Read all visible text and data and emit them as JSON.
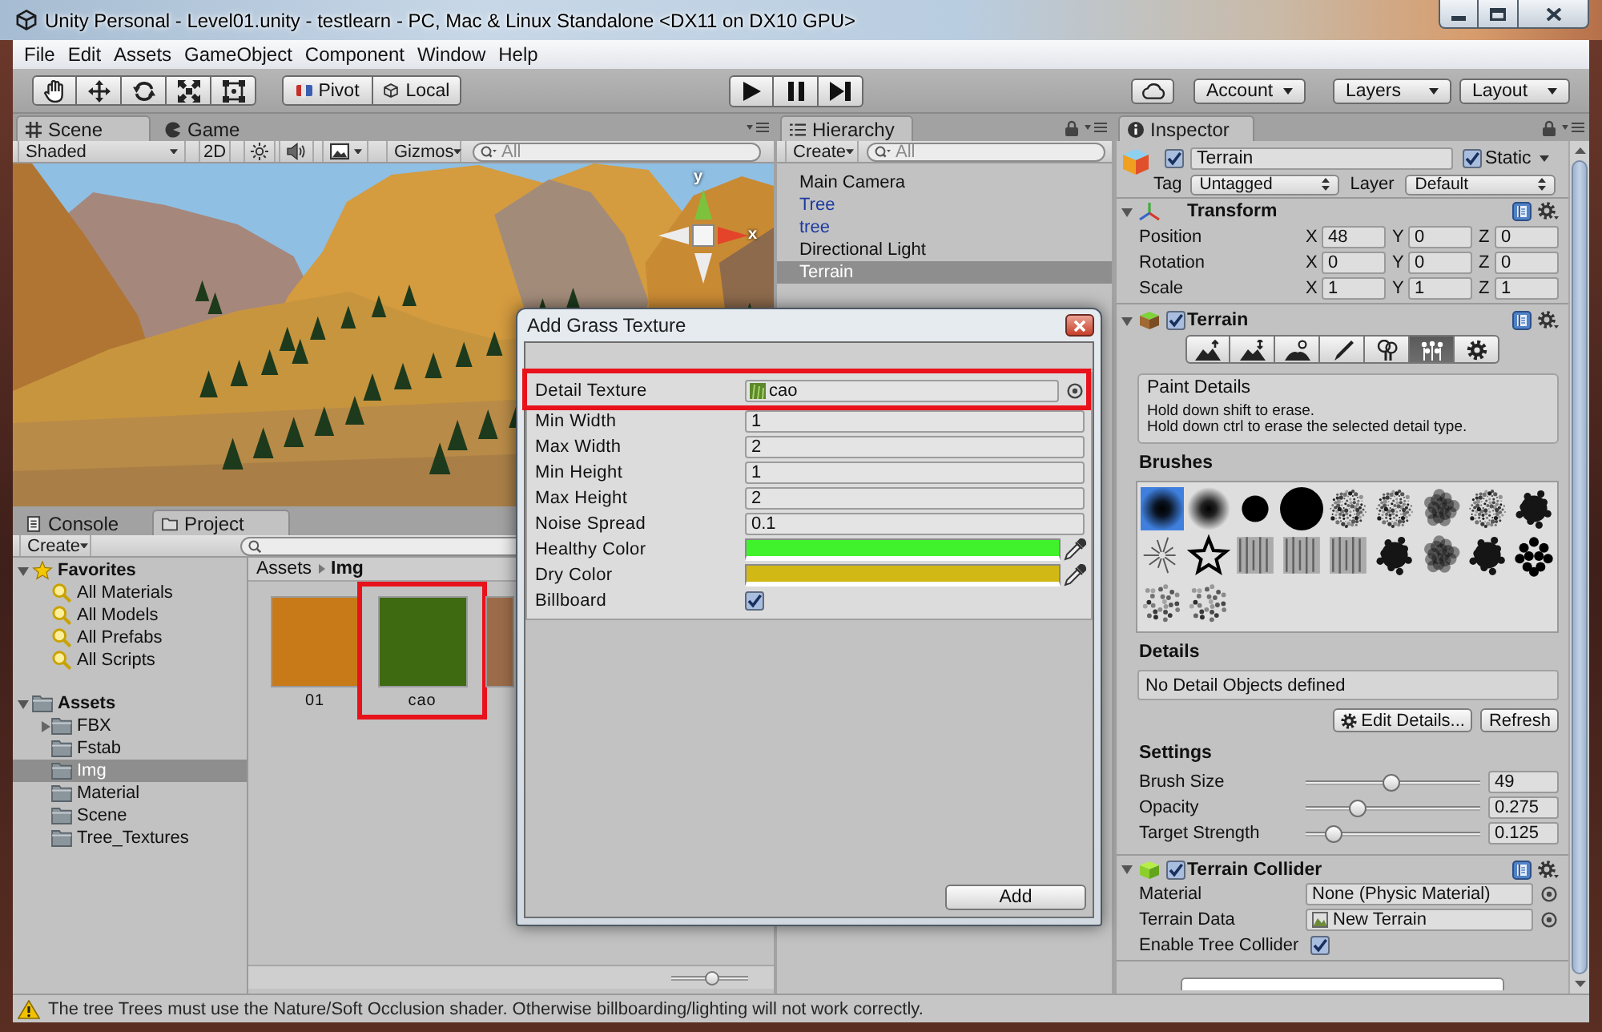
{
  "window": {
    "title": "Unity Personal - Level01.unity - testlearn - PC, Mac & Linux Standalone <DX11 on DX10 GPU>"
  },
  "menu": [
    "File",
    "Edit",
    "Assets",
    "GameObject",
    "Component",
    "Window",
    "Help"
  ],
  "toolbar": {
    "tools": [
      {
        "kind": "hand"
      },
      {
        "kind": "move"
      },
      {
        "kind": "rotate"
      },
      {
        "kind": "scale"
      },
      {
        "kind": "rect"
      }
    ],
    "handles": [
      {
        "kind": "pivot",
        "label": "Pivot"
      },
      {
        "kind": "local",
        "label": "Local"
      }
    ],
    "playback": [
      {
        "kind": "play",
        "on": false
      },
      {
        "kind": "pause",
        "on": false
      },
      {
        "kind": "step",
        "on": false
      }
    ],
    "account": "Account",
    "layers": "Layers",
    "layout": "Layout"
  },
  "scene": {
    "tabs": [
      {
        "kind": "scene",
        "label": "Scene",
        "selected": true
      },
      {
        "kind": "game",
        "label": "Game",
        "selected": false
      }
    ],
    "shading": "Shaded",
    "mode_2d": {
      "label": "2D",
      "on": false
    },
    "lighting": {
      "on": false
    },
    "audio": {
      "on": false
    },
    "gizmos": "Gizmos",
    "search": {
      "placeholder": "All"
    },
    "axes": [
      "y",
      "x"
    ]
  },
  "hierarchy": {
    "title": "Hierarchy",
    "create": "Create",
    "search": {
      "placeholder": "All"
    },
    "items": [
      {
        "name": "Main Camera",
        "prefab": false,
        "selected": false
      },
      {
        "name": "Tree",
        "prefab": true,
        "selected": false
      },
      {
        "name": "tree",
        "prefab": true,
        "selected": false
      },
      {
        "name": "Directional Light",
        "prefab": false,
        "selected": false
      },
      {
        "name": "Terrain",
        "prefab": false,
        "selected": true
      }
    ]
  },
  "inspector": {
    "title": "Inspector",
    "object": {
      "active": true,
      "name": "Terrain",
      "static": true,
      "static_label": "Static",
      "tag_label": "Tag",
      "tag": "Untagged",
      "layer_label": "Layer",
      "layer": "Default"
    },
    "transform": {
      "title": "Transform",
      "expanded": true,
      "rows": [
        {
          "label": "Position",
          "values": [
            {
              "axis": "X",
              "value": "48"
            },
            {
              "axis": "Y",
              "value": "0"
            },
            {
              "axis": "Z",
              "value": "0"
            }
          ]
        },
        {
          "label": "Rotation",
          "values": [
            {
              "axis": "X",
              "value": "0"
            },
            {
              "axis": "Y",
              "value": "0"
            },
            {
              "axis": "Z",
              "value": "0"
            }
          ]
        },
        {
          "label": "Scale",
          "values": [
            {
              "axis": "X",
              "value": "1"
            },
            {
              "axis": "Y",
              "value": "1"
            },
            {
              "axis": "Z",
              "value": "1"
            }
          ]
        }
      ]
    },
    "terrain": {
      "title": "Terrain",
      "enabled": true,
      "expanded": true,
      "tools": [
        {
          "kind": "raise",
          "selected": false
        },
        {
          "kind": "height",
          "selected": false
        },
        {
          "kind": "smooth",
          "selected": false
        },
        {
          "kind": "texture",
          "selected": false
        },
        {
          "kind": "trees",
          "selected": false
        },
        {
          "kind": "details",
          "selected": true
        },
        {
          "kind": "settings",
          "selected": false
        }
      ],
      "help": {
        "title": "Paint Details",
        "lines": [
          "Hold down shift to erase.",
          "Hold down ctrl to erase the selected detail type."
        ]
      },
      "brushes_label": "Brushes",
      "brushes": [
        {
          "kind": "soft",
          "selected": true
        },
        {
          "kind": "soft",
          "selected": false
        },
        {
          "kind": "dot",
          "selected": false
        },
        {
          "kind": "disc",
          "selected": false
        },
        {
          "kind": "spray",
          "selected": false
        },
        {
          "kind": "spray",
          "selected": false
        },
        {
          "kind": "cloud",
          "selected": false
        },
        {
          "kind": "spray",
          "selected": false
        },
        {
          "kind": "blob",
          "selected": false
        },
        {
          "kind": "burst",
          "selected": false
        },
        {
          "kind": "star",
          "selected": false
        },
        {
          "kind": "square",
          "selected": false
        },
        {
          "kind": "square",
          "selected": false
        },
        {
          "kind": "square",
          "selected": false
        },
        {
          "kind": "blob",
          "selected": false
        },
        {
          "kind": "cloud",
          "selected": false
        },
        {
          "kind": "blob",
          "selected": false
        },
        {
          "kind": "dots",
          "selected": false
        },
        {
          "kind": "scatter",
          "selected": false
        },
        {
          "kind": "scatter",
          "selected": false
        }
      ],
      "details_label": "Details",
      "details_empty": "No Detail Objects defined",
      "buttons": [
        {
          "kind": "edit",
          "label": "Edit Details..."
        },
        {
          "kind": "plain",
          "label": "Refresh"
        }
      ],
      "settings_label": "Settings",
      "sliders": [
        {
          "label": "Brush Size",
          "level": 0.49,
          "value": "49"
        },
        {
          "label": "Opacity",
          "level": 0.275,
          "value": "0.275"
        },
        {
          "label": "Target Strength",
          "level": 0.125,
          "value": "0.125"
        }
      ]
    },
    "collider": {
      "title": "Terrain Collider",
      "enabled": true,
      "expanded": true,
      "rows": [
        {
          "kind": "object",
          "label": "Material",
          "value": "None (Physic Material)"
        },
        {
          "kind": "asset",
          "label": "Terrain Data",
          "value": "New Terrain"
        },
        {
          "kind": "checkbox",
          "label": "Enable Tree Collider",
          "checked": true
        }
      ]
    }
  },
  "project": {
    "tabs": [
      {
        "kind": "console",
        "label": "Console",
        "selected": false
      },
      {
        "kind": "project",
        "label": "Project",
        "selected": true
      }
    ],
    "create": "Create",
    "tree": [
      {
        "kind": "favorites",
        "name": "Favorites",
        "expanded": true,
        "children": [
          {
            "kind": "search",
            "name": "All Materials",
            "expandable": false,
            "selected": false
          },
          {
            "kind": "search",
            "name": "All Models",
            "expandable": false,
            "selected": false
          },
          {
            "kind": "search",
            "name": "All Prefabs",
            "expandable": false,
            "selected": false
          },
          {
            "kind": "search",
            "name": "All Scripts",
            "expandable": false,
            "selected": false
          }
        ]
      },
      {
        "kind": "folder",
        "name": "Assets",
        "expanded": true,
        "children": [
          {
            "kind": "folder",
            "name": "FBX",
            "expandable": true,
            "selected": false
          },
          {
            "kind": "folder",
            "name": "Fstab",
            "expandable": false,
            "selected": false
          },
          {
            "kind": "folder",
            "name": "Img",
            "expandable": false,
            "selected": true
          },
          {
            "kind": "folder",
            "name": "Material",
            "expandable": false,
            "selected": false
          },
          {
            "kind": "folder",
            "name": "Scene",
            "expandable": false,
            "selected": false
          },
          {
            "kind": "folder",
            "name": "Tree_Textures",
            "expandable": false,
            "selected": false
          }
        ]
      }
    ],
    "breadcrumb": [
      "Assets",
      "Img"
    ],
    "assets": [
      {
        "kind": "full",
        "name": "01",
        "color": "#c97a18",
        "highlighted": false
      },
      {
        "kind": "full",
        "name": "cao",
        "color": "#3e6a12",
        "highlighted": true
      },
      {
        "kind": "cut",
        "color": "#9c6c4a",
        "highlighted": false
      }
    ],
    "thumbnail_size": {
      "level": 0.55
    }
  },
  "dialog": {
    "title": "Add Grass Texture",
    "fields": [
      {
        "kind": "asset",
        "label": "Detail Texture",
        "value": "cao",
        "highlighted": true
      },
      {
        "kind": "number",
        "label": "Min Width",
        "value": "1",
        "highlighted": false
      },
      {
        "kind": "number",
        "label": "Max Width",
        "value": "2",
        "highlighted": false
      },
      {
        "kind": "number",
        "label": "Min Height",
        "value": "1",
        "highlighted": false
      },
      {
        "kind": "number",
        "label": "Max Height",
        "value": "2",
        "highlighted": false
      },
      {
        "kind": "number",
        "label": "Noise Spread",
        "value": "0.1",
        "highlighted": false
      },
      {
        "kind": "color",
        "label": "Healthy Color",
        "color": "#40f22c",
        "highlighted": false
      },
      {
        "kind": "color",
        "label": "Dry Color",
        "color": "#d2b814",
        "highlighted": false
      },
      {
        "kind": "checkbox",
        "label": "Billboard",
        "checked": true,
        "highlighted": false
      }
    ],
    "button": "Add"
  },
  "status_bar": {
    "kind": "warning",
    "text": "The tree Trees must use the Nature/Soft Occlusion shader. Otherwise billboarding/lighting will not work correctly."
  }
}
